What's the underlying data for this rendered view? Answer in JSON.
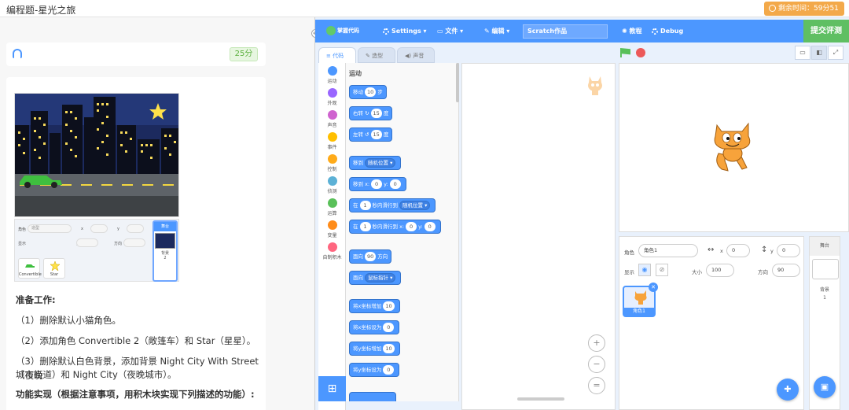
{
  "topbar": {
    "title": "编程题-星光之旅",
    "timer_text": "剩余时间：59分51秒"
  },
  "left": {
    "score": "25分",
    "reference": {
      "sprite_label": "角色",
      "sprite_name": "造型",
      "x": "x",
      "y": "y",
      "show": "显示",
      "size": "大小",
      "direction": "方向",
      "sprites": [
        "Convertible",
        "Star"
      ],
      "stage_label": "舞台",
      "backdrop_label": "背景",
      "backdrop_count": "2"
    },
    "content": {
      "prep_title": "准备工作:",
      "step1": "（1）删除默认小猫角色。",
      "step2": "（2）添加角色 Convertible 2（敞篷车）和 Star（星星）。",
      "step3a": "（3）删除默认白色背景，添加背景 Night City With Street（夜晚",
      "step3b": "城市街道）和 Night City（夜晚城市）。",
      "func_title": "功能实现（根据注意事项，用积木块实现下列描述的功能）:"
    }
  },
  "editor": {
    "logo_text": "掌握代码",
    "menu": {
      "settings": "Settings",
      "file": "文件",
      "edit": "编辑",
      "tutorial": "教程",
      "debug": "Debug"
    },
    "project_name": "Scratch作品",
    "submit": "提交评测",
    "tabs": [
      "代码",
      "造型",
      "声音"
    ],
    "categories": [
      {
        "name": "运动",
        "color": "#4c97ff"
      },
      {
        "name": "外观",
        "color": "#9966ff"
      },
      {
        "name": "声音",
        "color": "#cf63cf"
      },
      {
        "name": "事件",
        "color": "#ffbf00"
      },
      {
        "name": "控制",
        "color": "#ffab19"
      },
      {
        "name": "侦测",
        "color": "#5cb1d6"
      },
      {
        "name": "运算",
        "color": "#59c059"
      },
      {
        "name": "变量",
        "color": "#ff8c1a"
      },
      {
        "name": "自制积木",
        "color": "#ff6680"
      }
    ],
    "palette_header": "运动",
    "blocks": {
      "move": {
        "pre": "移动",
        "val": "10",
        "post": "步"
      },
      "turn_right": {
        "pre": "右转",
        "icon": "↻",
        "val": "15",
        "post": "度"
      },
      "turn_left": {
        "pre": "左转",
        "icon": "↺",
        "val": "15",
        "post": "度"
      },
      "goto": {
        "pre": "移到",
        "dd": "随机位置 ▾"
      },
      "goto_xy": {
        "pre": "移到 x:",
        "x": "0",
        "mid": "y:",
        "y": "0"
      },
      "glide": {
        "pre": "在",
        "val": "1",
        "mid": "秒内滑行到",
        "dd": "随机位置 ▾"
      },
      "glide_xy": {
        "pre": "在",
        "val": "1",
        "mid": "秒内滑行到 x:",
        "x": "0",
        "ymid": "y:",
        "y": "0"
      },
      "point": {
        "pre": "面向",
        "val": "90",
        "post": "方向"
      },
      "point_to": {
        "pre": "面向",
        "dd": "鼠标指针 ▾"
      },
      "change_x": {
        "pre": "将x坐标增加",
        "val": "10"
      },
      "set_x": {
        "pre": "将x坐标设为",
        "val": "0"
      },
      "change_y": {
        "pre": "将y坐标增加",
        "val": "10"
      },
      "set_y": {
        "pre": "将y坐标设为",
        "val": "0"
      }
    },
    "zoom": {
      "in": "+",
      "out": "−",
      "reset": "="
    },
    "sprite_info": {
      "sprite_label": "角色",
      "sprite_name": "角色1",
      "x_label": "x",
      "x_val": "0",
      "y_label": "y",
      "y_val": "0",
      "show_label": "显示",
      "size_label": "大小",
      "size_val": "100",
      "dir_label": "方向",
      "dir_val": "90"
    },
    "sprite_card": "角色1",
    "stage_panel": {
      "title": "舞台",
      "backdrop_label": "背景",
      "backdrop_count": "1"
    }
  }
}
